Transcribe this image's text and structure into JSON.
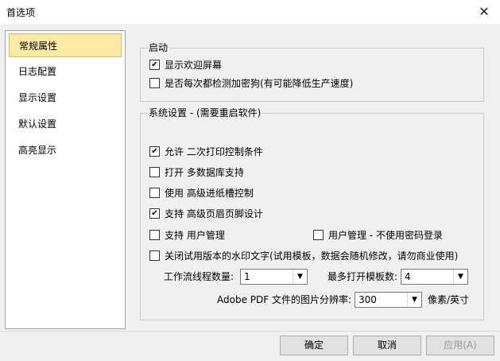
{
  "window": {
    "title": "首选项",
    "close_glyph": "✕"
  },
  "sidebar": {
    "items": [
      {
        "label": "常规属性",
        "selected": true
      },
      {
        "label": "日志配置",
        "selected": false
      },
      {
        "label": "显示设置",
        "selected": false
      },
      {
        "label": "默认设置",
        "selected": false
      },
      {
        "label": "高亮显示",
        "selected": false
      }
    ]
  },
  "startup": {
    "title": "启动",
    "show_welcome": {
      "label": "显示欢迎屏幕",
      "checked": true
    },
    "check_dongle": {
      "label": "是否每次都检测加密狗(有可能降低生产速度)",
      "checked": false
    }
  },
  "system": {
    "title": "系统设置 - (需要重启软件)",
    "options": {
      "print_conditions": {
        "label": "允许 二次打印控制条件",
        "checked": true
      },
      "multi_db": {
        "label": "打开 多数据库支持",
        "checked": false
      },
      "paper_slot": {
        "label": "使用 高级进纸槽控制",
        "checked": false
      },
      "header_footer": {
        "label": "支持 高级页眉页脚设计",
        "checked": true
      },
      "user_mgmt": {
        "label": "支持 用户管理",
        "checked": false
      },
      "no_password": {
        "label": "用户管理 - 不使用密码登录",
        "checked": false
      },
      "watermark": {
        "label": "关闭试用版本的水印文字(试用模板，数据会随机修改，请勿商业使用)",
        "checked": false
      }
    },
    "workflow_threads": {
      "label": "工作流线程数量:",
      "value": "1"
    },
    "max_templates": {
      "label": "最多打开模板数:",
      "value": "4"
    },
    "pdf_resolution": {
      "label": "Adobe PDF 文件的图片分辨率:",
      "value": "300",
      "unit": "像素/英寸"
    }
  },
  "buttons": {
    "ok": "确定",
    "cancel": "取消",
    "apply": "应用(A)"
  },
  "check_glyph": "✔"
}
